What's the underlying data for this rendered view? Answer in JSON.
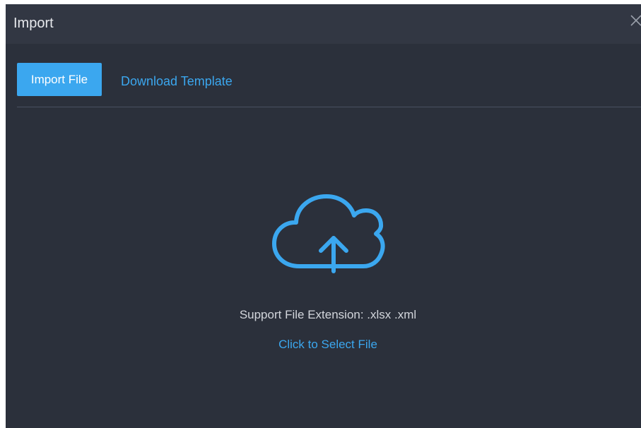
{
  "dialog": {
    "title": "Import",
    "close_icon": "close-icon"
  },
  "toolbar": {
    "import_file_label": "Import File",
    "download_template_label": "Download Template"
  },
  "upload": {
    "icon": "cloud-upload-icon",
    "support_text": "Support File Extension: .xlsx .xml",
    "select_label": "Click to Select File"
  },
  "colors": {
    "accent": "#3ba7ef",
    "dialog_bg": "#2b303b",
    "titlebar_bg": "#323743"
  }
}
